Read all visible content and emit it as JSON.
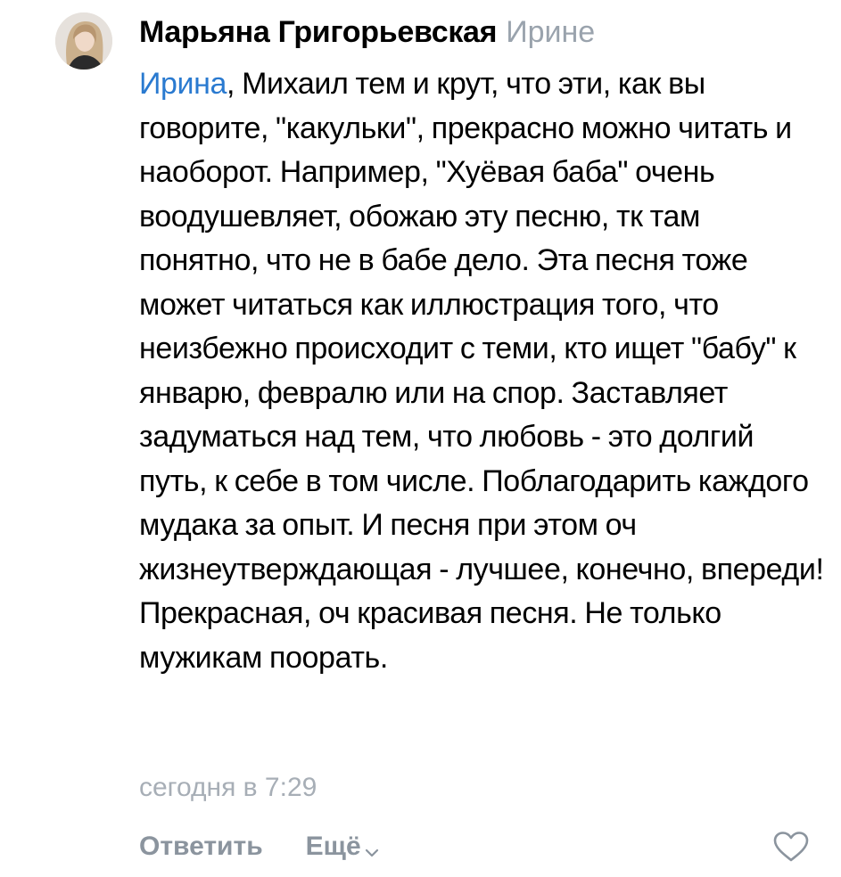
{
  "comment": {
    "author": "Марьяна Григорьевская",
    "reply_to": "Ирине",
    "mention": "Ирина",
    "text": ", Михаил тем и крут, что эти, как вы говорите, \"какульки\", прекрасно можно читать и наоборот. Например, \"Хуёвая баба\" очень воодушевляет, обожаю эту песню, тк там понятно, что не в бабе дело. Эта песня тоже может читаться как иллюстрация того, что неизбежно происходит с теми, кто ищет \"бабу\" к январю, февралю или на спор. Заставляет задуматься над тем, что любовь - это долгий путь, к себе в том числе. Поблагодарить каждого мудака за опыт. И песня при этом оч жизнеутверждающая - лучшее, конечно, впереди! Прекрасная, оч красивая песня. Не только мужикам поорать.",
    "timestamp": "сегодня в 7:29"
  },
  "actions": {
    "reply_label": "Ответить",
    "more_label": "Ещё",
    "more_icon": "chevron-down-icon",
    "like_icon": "heart-outline-icon"
  },
  "colors": {
    "mention": "#2a7ad0",
    "muted": "#9aa3ad",
    "action": "#8b949e"
  }
}
